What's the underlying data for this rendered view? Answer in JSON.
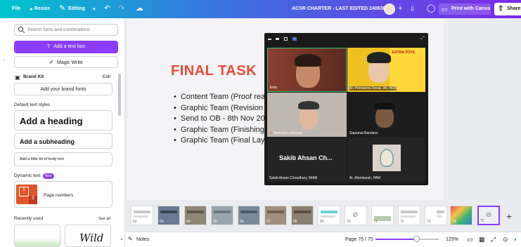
{
  "topbar": {
    "file": "File",
    "resize": "Resize",
    "editing": "Editing",
    "doc_title": "ACSR CHARTER - LAST EDITED 240630",
    "print": "Print with Canva",
    "share": "Share"
  },
  "sidebar": {
    "search_placeholder": "Search fonts and combinations",
    "add_text_box": "Add a text box",
    "magic_write": "Magic Write",
    "brand_kit": "Brand Kit",
    "edit": "Edit",
    "add_brand_fonts": "Add your brand fonts",
    "default_text_styles": "Default text styles",
    "add_heading": "Add a heading",
    "add_subheading": "Add a subheading",
    "add_body": "Add a little bit of body text",
    "dynamic_text": "Dynamic text",
    "new_badge": "New",
    "page_numbers": "Page numbers",
    "page_num_a": "1",
    "page_num_b": "2",
    "recently_used": "Recently used",
    "see_all": "See all",
    "font_preview": "Wild"
  },
  "slide": {
    "title": "FINAL TASK",
    "bullets": [
      "Content Team (Proof rea",
      "Graphic Team (Revision",
      "Send to OB - 8th Nov 20",
      "Graphic Team (Finishing",
      "Graphic Team (Final Lay"
    ]
  },
  "zoom": {
    "participants": [
      {
        "name": "Emu"
      },
      {
        "name": "Ar. Primavera Desta, IAI, HCB"
      },
      {
        "name": "Vanessa Ledesma"
      },
      {
        "name": "Sapumal Bandara"
      },
      {
        "name": "Sakib Ahsan Choudhury, MIAB",
        "display": "Sakib Ahsan Ch..."
      },
      {
        "name": "Ar. Mumtazah, PAM"
      }
    ],
    "banner": "EXTRA TOYS"
  },
  "filmstrip": {
    "thumbs": [
      "62",
      "63",
      "64",
      "65",
      "66",
      "67",
      "68",
      "69",
      "70",
      "71",
      "72",
      "73",
      "74",
      "75"
    ]
  },
  "bottombar": {
    "notes": "Notes",
    "page": "Page 75 / 75",
    "zoom": "125%"
  },
  "colors": {
    "accent": "#8b3dff",
    "title_red": "#e74a3b",
    "active_speaker": "#2ecc71"
  }
}
